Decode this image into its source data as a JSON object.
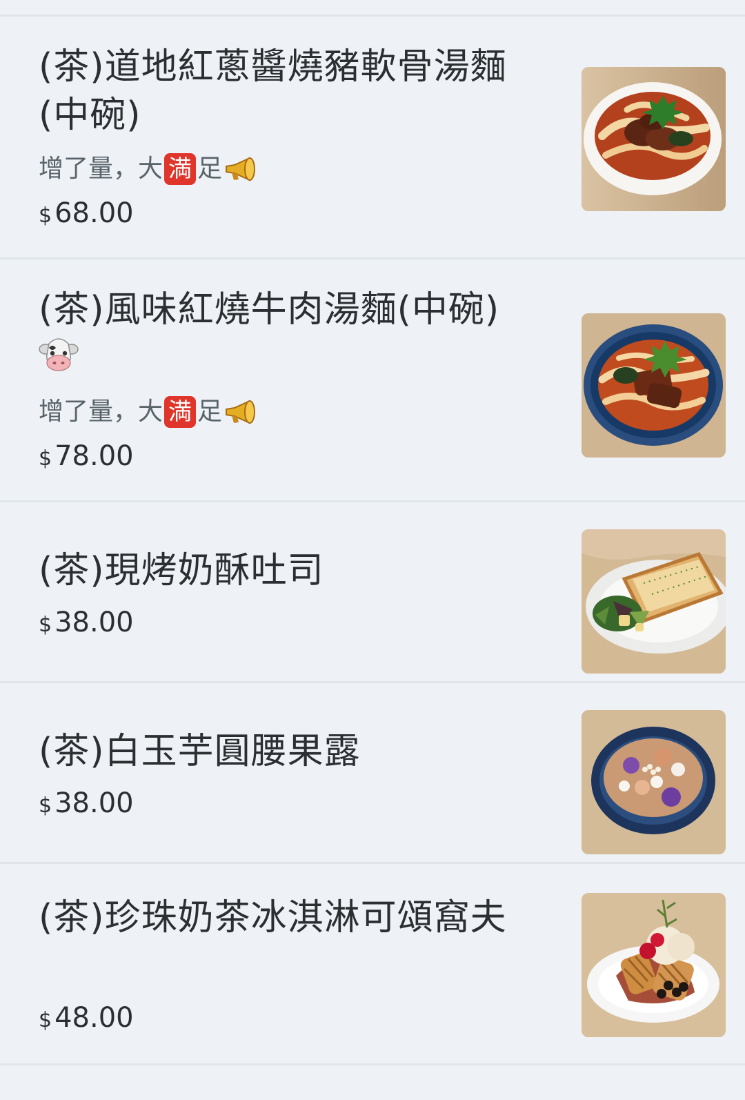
{
  "currency_symbol": "$",
  "menu_items": [
    {
      "title": "(茶)道地紅蔥醬燒豬軟骨湯麵(中碗)",
      "note_prefix": "增了量，大",
      "note_badge": "満",
      "note_suffix": "足",
      "note_icon": "megaphone-icon",
      "price": "68.00",
      "image_icon": "pork-noodle-bowl-image"
    },
    {
      "title": "(茶)風味紅燒牛肉湯麵(中碗)",
      "title_emoji": "cow-face-icon",
      "note_prefix": "增了量，大",
      "note_badge": "満",
      "note_suffix": "足",
      "note_icon": "megaphone-icon",
      "price": "78.00",
      "image_icon": "beef-noodle-bowl-image"
    },
    {
      "title": "(茶)現烤奶酥吐司",
      "price": "38.00",
      "image_icon": "toast-salad-image"
    },
    {
      "title": "(茶)白玉芋圓腰果露",
      "price": "38.00",
      "image_icon": "taro-ball-dessert-image"
    },
    {
      "title": "(茶)珍珠奶茶冰淇淋可頌窩夫",
      "price": "48.00",
      "image_icon": "waffle-ice-cream-image"
    }
  ],
  "colors": {
    "background": "#eef2f6",
    "divider": "#dfe5ea",
    "text": "#2b2f31",
    "muted_text": "#59636a",
    "badge": "#e0352a"
  }
}
